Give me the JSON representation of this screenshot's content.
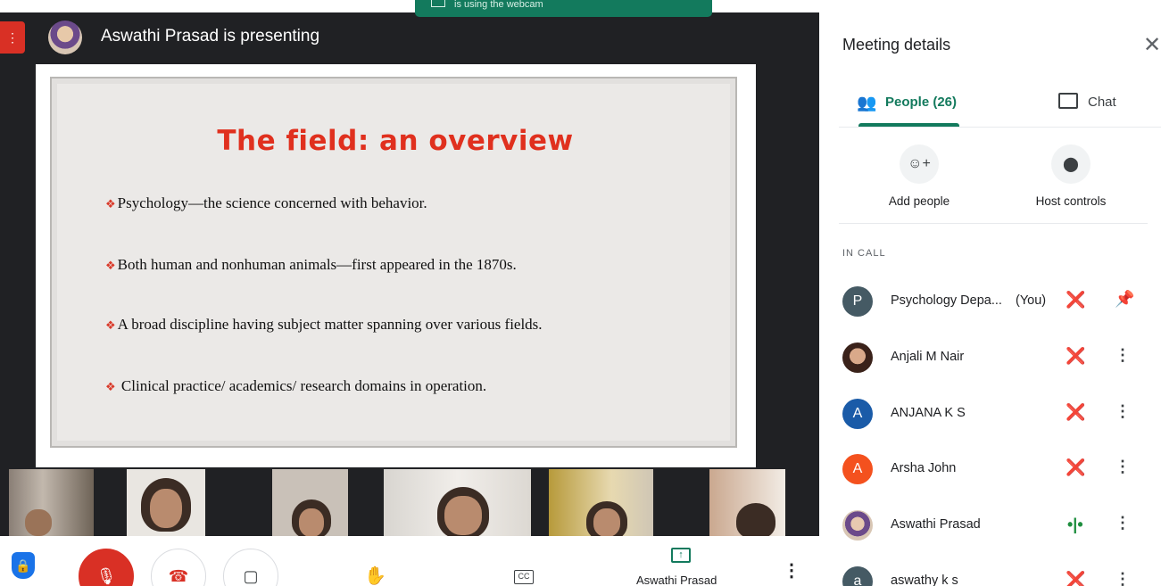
{
  "presenter_bar": {
    "text": "Aswathi Prasad is presenting",
    "webcam_notice": "is using the webcam"
  },
  "slide": {
    "title": "The field: an overview",
    "bullets": [
      "Psychology—the science concerned with behavior.",
      "Both human and nonhuman animals—first appeared in the 1870s.",
      "A broad discipline having subject matter spanning over various fields.",
      " Clinical practice/ academics/ research domains in operation."
    ],
    "bullet_glyph": "❖"
  },
  "controls": {
    "present_label": "Aswathi Prasad",
    "cc_label": "CC"
  },
  "panel": {
    "title": "Meeting details",
    "close_glyph": "✕",
    "tabs": {
      "people": "People (26)",
      "chat": "Chat"
    },
    "actions": {
      "add_people": "Add people",
      "host_controls": "Host controls"
    },
    "section_label": "IN CALL",
    "participants": [
      {
        "initial": "P",
        "name": "Psychology Depa...",
        "you": "(You)",
        "color": "#455a64",
        "status": "muted",
        "action": "pin-icon"
      },
      {
        "initial": "",
        "name": "Anjali M Nair",
        "color": "#5b3b32",
        "status": "muted",
        "action": "more-icon"
      },
      {
        "initial": "A",
        "name": "ANJANA K S",
        "color": "#1a5ba8",
        "status": "muted",
        "action": "more-icon"
      },
      {
        "initial": "A",
        "name": "Arsha John",
        "color": "#f4511e",
        "status": "muted",
        "action": "more-icon"
      },
      {
        "initial": "",
        "name": "Aswathi Prasad",
        "color": "#c9b8b0",
        "status": "speaking",
        "action": "more-icon"
      },
      {
        "initial": "a",
        "name": "aswathy k s",
        "color": "#455a64",
        "status": "muted",
        "action": "more-icon"
      }
    ]
  },
  "colors": {
    "accent": "#137a5d",
    "danger": "#d93025",
    "slide_title": "#e0301e"
  }
}
